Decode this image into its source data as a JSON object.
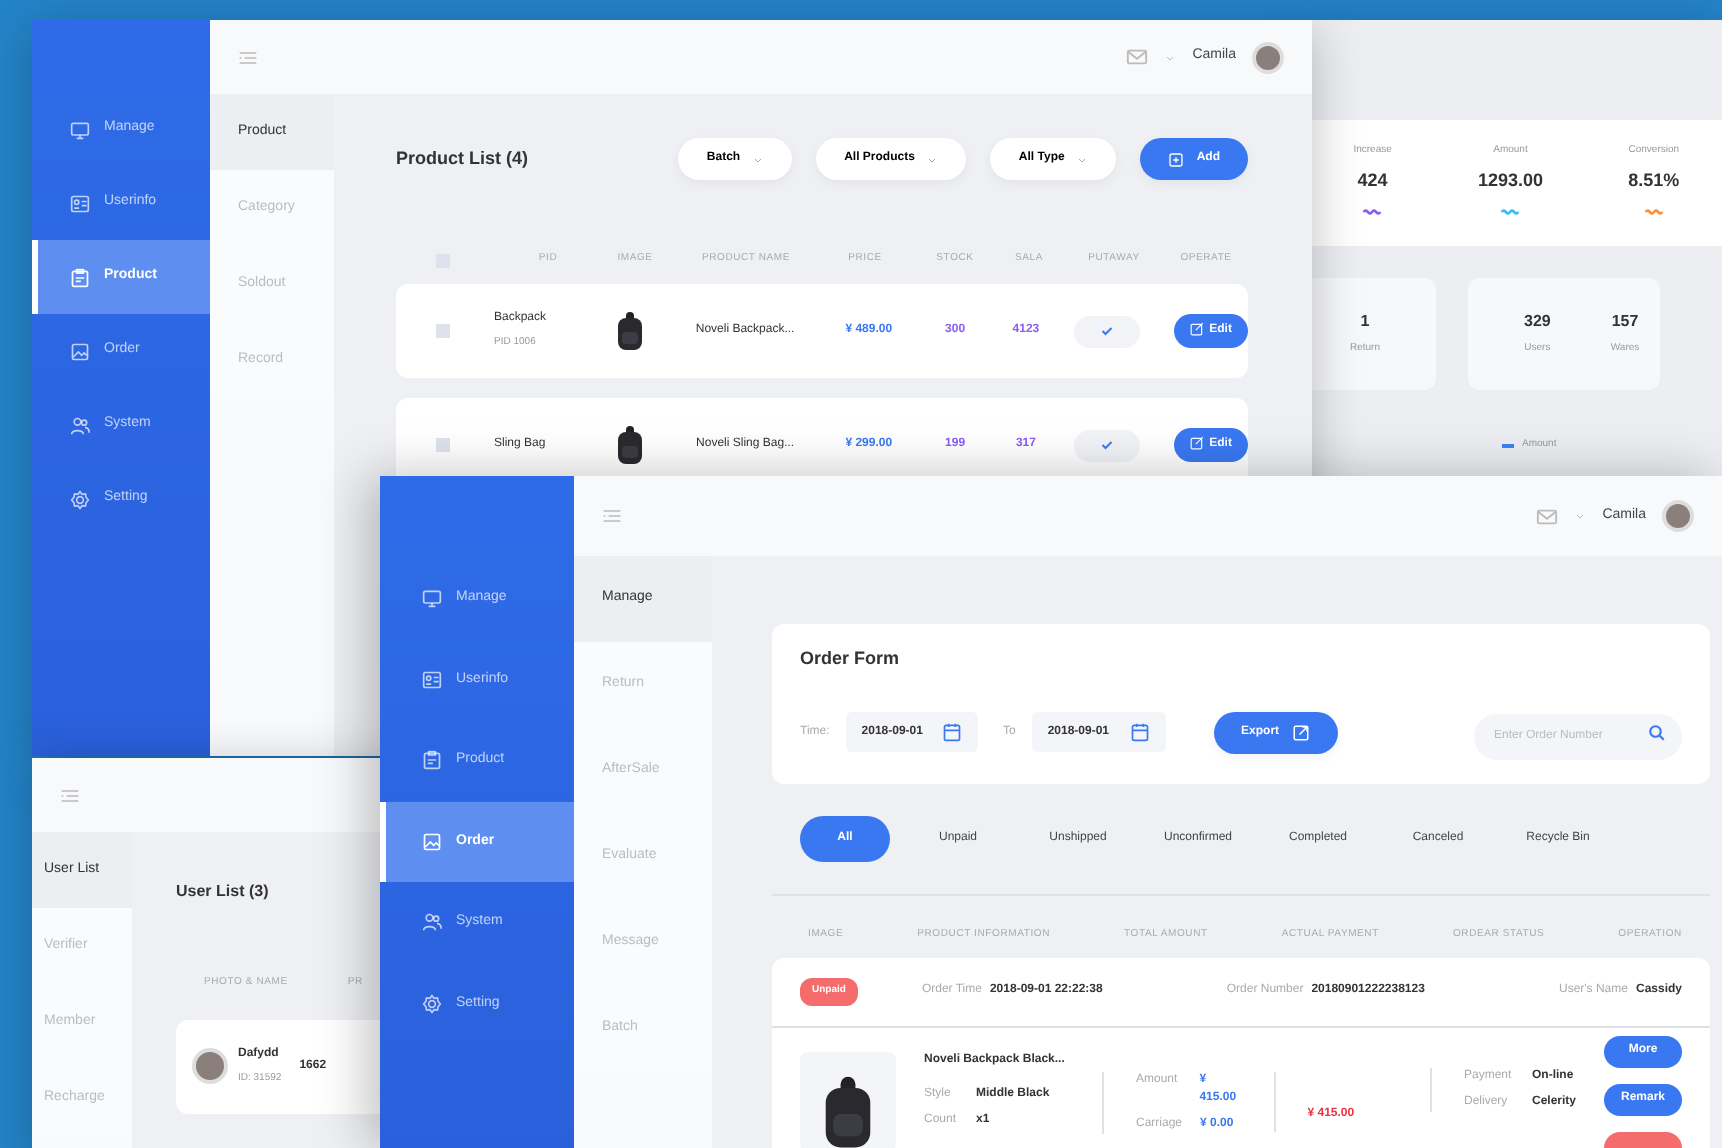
{
  "product_window": {
    "sidebar": [
      {
        "label": "Manage",
        "selected": false
      },
      {
        "label": "Userinfo",
        "selected": false
      },
      {
        "label": "Product",
        "selected": true
      },
      {
        "label": "Order",
        "selected": false
      },
      {
        "label": "System",
        "selected": false
      },
      {
        "label": "Setting",
        "selected": false
      }
    ],
    "user": "Camila",
    "subnav": [
      {
        "label": "Product",
        "selected": true
      },
      {
        "label": "Category",
        "selected": false
      },
      {
        "label": "Soldout",
        "selected": false
      },
      {
        "label": "Record",
        "selected": false
      }
    ],
    "title": "Product List (4)",
    "filters": [
      "Batch",
      "All Products",
      "All Type"
    ],
    "add_button": "Add",
    "select_all": {
      "checked": false
    },
    "columns": [
      "PID",
      "IMAGE",
      "PRODUCT NAME",
      "PRICE",
      "STOCK",
      "SALA",
      "PUTAWAY",
      "OPERATE"
    ],
    "rows": [
      {
        "checked": false,
        "name": "Backpack",
        "pid": "PID 1006",
        "product": "Noveli Backpack...",
        "price": "¥ 489.00",
        "stock": "300",
        "sala": "4123",
        "putaway": true,
        "button": "Edit"
      },
      {
        "checked": false,
        "name": "Sling Bag",
        "product": "Noveli Sling Bag...",
        "price": "¥ 299.00",
        "stock": "199",
        "sala": "317",
        "putaway": true,
        "button": "Edit"
      }
    ]
  },
  "dashboard_window": {
    "stats": [
      {
        "label": "Increase",
        "value": "424",
        "color": "#8b5cf6"
      },
      {
        "label": "Amount",
        "value": "1293.00",
        "color": "#38bdf8"
      },
      {
        "label": "Conversion",
        "value": "8.51%",
        "color": "#fb923c"
      }
    ],
    "count_cards": [
      [
        {
          "value": "1",
          "label": "Return"
        }
      ],
      [
        {
          "value": "329",
          "label": "Users"
        },
        {
          "value": "157",
          "label": "Wares"
        }
      ]
    ],
    "legend": [
      {
        "label": "Amount",
        "color": "#3b82f6"
      }
    ]
  },
  "user_window": {
    "subnav": [
      {
        "label": "User List",
        "selected": true
      },
      {
        "label": "Verifier",
        "selected": false
      },
      {
        "label": "Member",
        "selected": false
      },
      {
        "label": "Recharge",
        "selected": false
      }
    ],
    "title": "User List (3)",
    "columns": [
      "PHOTO & NAME",
      "PR"
    ],
    "rows": [
      {
        "name": "Dafydd",
        "id": "ID: 31592",
        "column_2": "1662"
      }
    ]
  },
  "order_window": {
    "sidebar": [
      {
        "label": "Manage",
        "selected": false
      },
      {
        "label": "Userinfo",
        "selected": false
      },
      {
        "label": "Product",
        "selected": false
      },
      {
        "label": "Order",
        "selected": true
      },
      {
        "label": "System",
        "selected": false
      },
      {
        "label": "Setting",
        "selected": false
      }
    ],
    "user": "Camila",
    "subnav": [
      {
        "label": "Manage",
        "selected": true
      },
      {
        "label": "Return",
        "selected": false
      },
      {
        "label": "AfterSale",
        "selected": false
      },
      {
        "label": "Evaluate",
        "selected": false
      },
      {
        "label": "Message",
        "selected": false
      },
      {
        "label": "Batch",
        "selected": false
      }
    ],
    "form_title": "Order Form",
    "time_label": "Time:",
    "dates": [
      "2018-09-01",
      "2018-09-01"
    ],
    "to_label": "To",
    "export_button": "Export",
    "search": {
      "placeholder": "Enter Order Number"
    },
    "tabs": [
      {
        "label": "All",
        "selected": true
      },
      {
        "label": "Unpaid",
        "selected": false
      },
      {
        "label": "Unshipped",
        "selected": false
      },
      {
        "label": "Unconfirmed",
        "selected": false
      },
      {
        "label": "Completed",
        "selected": false
      },
      {
        "label": "Canceled",
        "selected": false
      },
      {
        "label": "Recycle Bin",
        "selected": false
      }
    ],
    "columns": [
      "IMAGE",
      "PRODUCT INFORMATION",
      "TOTAL AMOUNT",
      "ACTUAL PAYMENT",
      "ORDEAR STATUS",
      "OPERATION"
    ],
    "order": {
      "status": "Unpaid",
      "fields": [
        {
          "label": "Order Time",
          "value": "2018-09-01 22:22:38"
        },
        {
          "label": "Order Number",
          "value": "20180901222238123"
        },
        {
          "label": "User's Name",
          "value": "Cassidy"
        }
      ],
      "item": {
        "name": "Noveli Backpack Black...",
        "specs": [
          {
            "label": "Style",
            "value": "Middle Black"
          },
          {
            "label": "Count",
            "value": "x1"
          }
        ],
        "amounts": [
          {
            "label": "Amount",
            "value": "¥ 415.00"
          },
          {
            "label": "Carriage",
            "value": "¥ 0.00"
          }
        ],
        "payment": "¥ 415.00",
        "delivery": [
          {
            "label": "Payment",
            "value": "On-line"
          },
          {
            "label": "Delivery",
            "value": "Celerity"
          }
        ]
      },
      "buttons": [
        {
          "label": "More",
          "kind": "primary"
        },
        {
          "label": "Remark",
          "kind": "primary"
        },
        {
          "kind": "danger"
        }
      ]
    }
  }
}
